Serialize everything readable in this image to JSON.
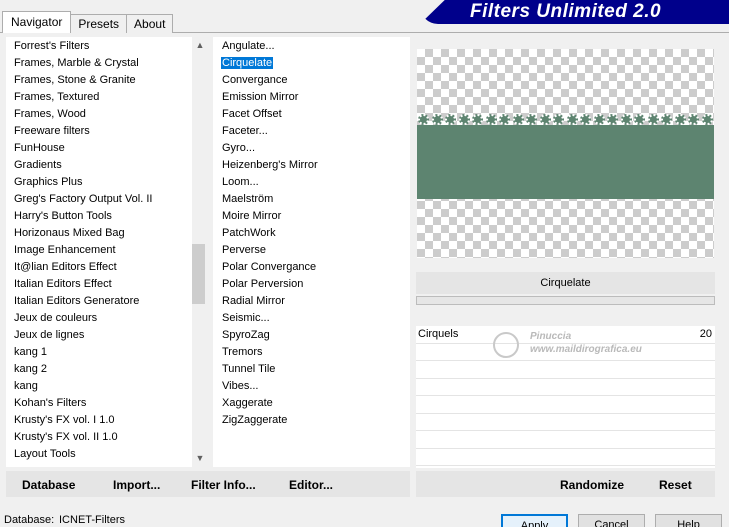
{
  "tabs": [
    "Navigator",
    "Presets",
    "About"
  ],
  "banner": "Filters Unlimited 2.0",
  "categories": [
    "Forrest's Filters",
    "Frames, Marble & Crystal",
    "Frames, Stone & Granite",
    "Frames, Textured",
    "Frames, Wood",
    "Freeware filters",
    "FunHouse",
    "Gradients",
    "Graphics Plus",
    "Greg's Factory Output Vol. II",
    "Harry's Button Tools",
    "Horizonaus Mixed Bag",
    "Image Enhancement",
    "It@lian Editors Effect",
    "Italian Editors Effect",
    "Italian Editors Generatore",
    "Jeux de couleurs",
    "Jeux de lignes",
    "kang 1",
    "kang 2",
    "kang",
    "Kohan's Filters",
    "Krusty's FX vol. I 1.0",
    "Krusty's FX vol. II 1.0",
    "Layout Tools"
  ],
  "filters": [
    "Angulate...",
    "Cirquelate",
    "Convergance",
    "Emission Mirror",
    "Facet Offset",
    "Faceter...",
    "Gyro...",
    "Heizenberg's Mirror",
    "Loom...",
    "Maelström",
    "Moire Mirror",
    "PatchWork",
    "Perverse",
    "Polar Convergance",
    "Polar Perversion",
    "Radial Mirror",
    "Seismic...",
    "SpyroZag",
    "Tremors",
    "Tunnel Tile",
    "Vibes...",
    "Xaggerate",
    "ZigZaggerate"
  ],
  "selected_filter": "Cirquelate",
  "filter_name_display": "Cirquelate",
  "params": [
    {
      "label": "Cirquels",
      "value": "20"
    }
  ],
  "watermark": {
    "line1": "Pinuccia",
    "line2": "www.maildirografica.eu"
  },
  "left_buttons": [
    "Database",
    "Import...",
    "Filter Info...",
    "Editor..."
  ],
  "right_buttons": [
    "Randomize",
    "Reset"
  ],
  "status": {
    "label": "Database:",
    "value": "ICNET-Filters"
  },
  "bottom_buttons": {
    "apply": "Apply",
    "cancel": "Cancel",
    "help": "Help"
  },
  "colors": {
    "accent": "#0078d7",
    "banner": "#00008b",
    "preview_band": "#5d8470"
  }
}
